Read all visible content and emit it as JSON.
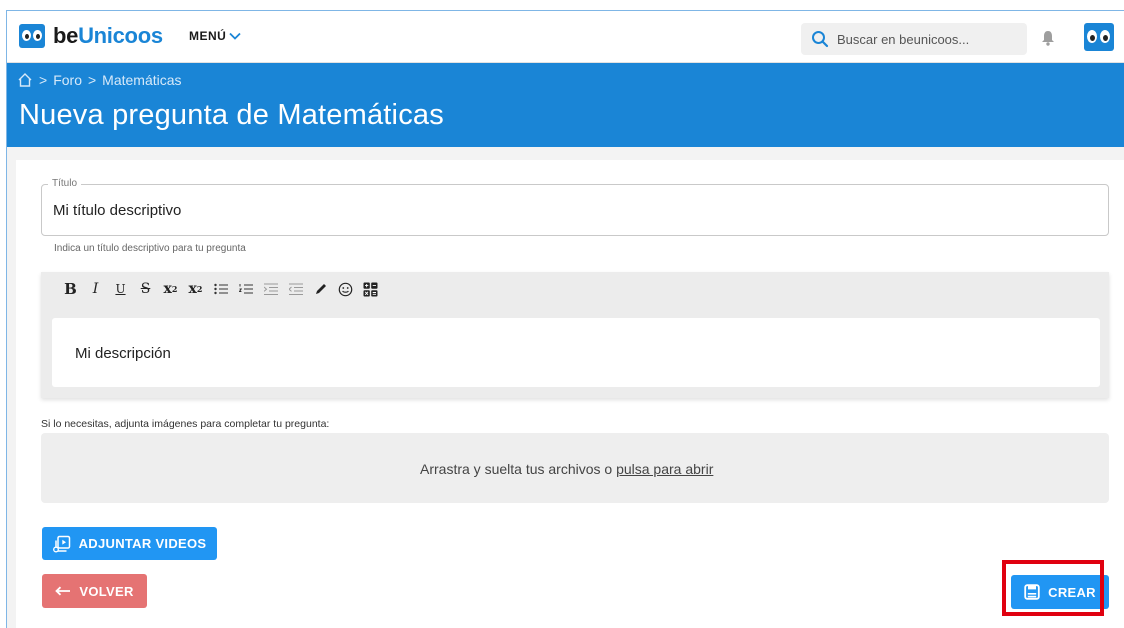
{
  "header": {
    "logo_text_be": "be",
    "logo_text_brand": "Unicoos",
    "menu_label": "MENÚ",
    "search_placeholder": "Buscar en beunicoos...",
    "accent_color": "#1a85d6"
  },
  "banner": {
    "breadcrumb": [
      "Foro",
      "Matemáticas"
    ],
    "title": "Nueva pregunta de Matemáticas"
  },
  "form": {
    "title_label": "Título",
    "title_value": "Mi título descriptivo",
    "title_help": "Indica un título descriptivo para tu pregunta",
    "editor_tools": [
      "bold",
      "italic",
      "underline",
      "strikethrough",
      "superscript",
      "subscript",
      "bullet-list",
      "numbered-list",
      "indent",
      "outdent",
      "pen",
      "emoji",
      "formula"
    ],
    "editor_text": "Mi descripción",
    "attach_label": "Si lo necesitas, adjunta imágenes para completar tu pregunta:",
    "dropzone_text": "Arrastra y suelta tus archivos o ",
    "dropzone_link": "pulsa para abrir"
  },
  "buttons": {
    "videos": "ADJUNTAR VIDEOS",
    "back": "VOLVER",
    "create": "CREAR"
  }
}
